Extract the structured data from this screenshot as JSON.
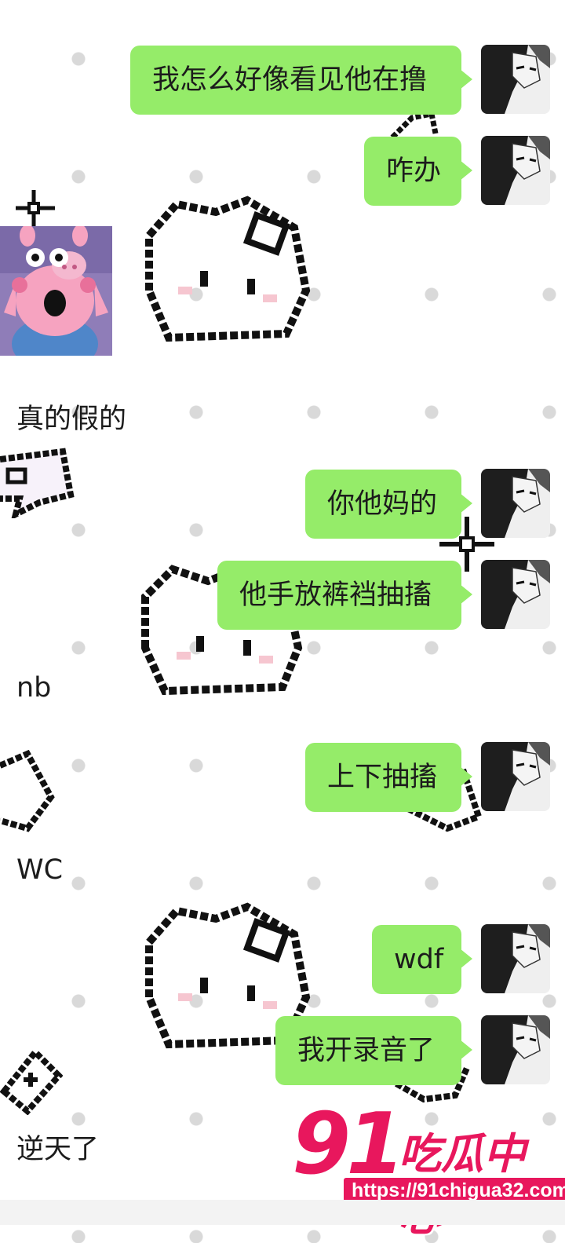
{
  "messages_right": [
    {
      "text": "我怎么好像看见他在撸"
    },
    {
      "text": "咋办"
    },
    {
      "text": "你他妈的"
    },
    {
      "text": "他手放裤裆抽搐"
    },
    {
      "text": "上下抽搐"
    },
    {
      "text": "wdf"
    },
    {
      "text": "我开录音了"
    }
  ],
  "messages_left": [
    {
      "text": "真的假的"
    },
    {
      "text": "nb"
    },
    {
      "text": "WC"
    },
    {
      "text": "逆天了"
    }
  ],
  "watermark": {
    "number": "91",
    "name": "吃瓜中心",
    "url": "https://91chigua32.com"
  },
  "colors": {
    "bubble": "#95ec69",
    "brand": "#e8175d"
  }
}
